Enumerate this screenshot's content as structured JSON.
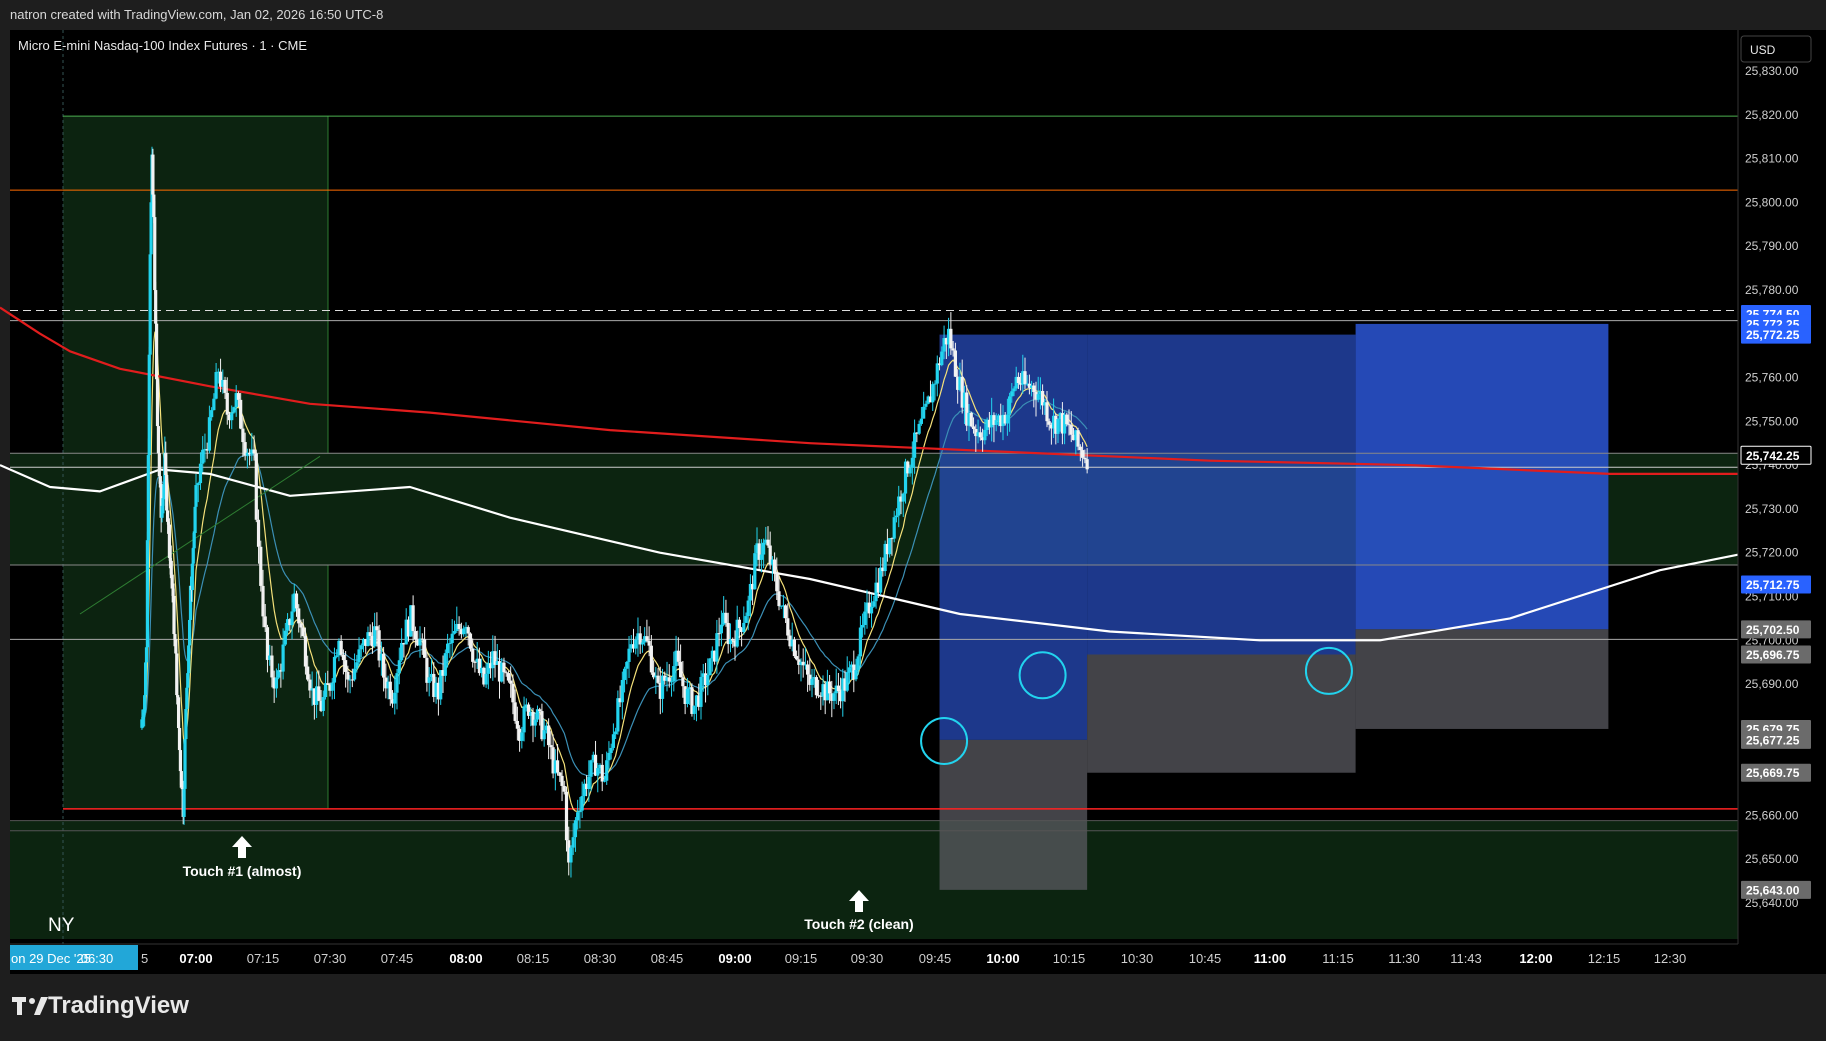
{
  "header": {
    "attribution": "natron created with TradingView.com, Jan 02, 2026 16:50 UTC-8"
  },
  "chart_title": "Micro E-mini Nasdaq-100 Index Futures · 1 · CME",
  "currency": "USD",
  "footer": {
    "brand": "TradingView"
  },
  "session_label": "NY",
  "annotations": [
    {
      "text": "Touch #1 (almost)",
      "time": "07:15"
    },
    {
      "text": "Touch #2 (clean)",
      "time": "09:30"
    }
  ],
  "chart_data": {
    "type": "candlestick",
    "symbol": "Micro E-mini Nasdaq-100 Index Futures",
    "interval": "1",
    "exchange": "CME",
    "ylim": [
      25636,
      25836
    ],
    "y_ticks": [
      "25,830.00",
      "25,820.00",
      "25,810.00",
      "25,800.00",
      "25,790.00",
      "25,780.00",
      "25,770.00",
      "25,760.00",
      "25,750.00",
      "25,740.00",
      "25,730.00",
      "25,720.00",
      "25,710.00",
      "25,700.00",
      "25,690.00",
      "25,680.00",
      "25,670.00",
      "25,660.00",
      "25,650.00",
      "25,640.00"
    ],
    "x_ticks": [
      {
        "label": "on 29 Dec '25",
        "highlight": true
      },
      {
        "label": "06:30",
        "highlight": true
      },
      {
        "label": "07:00",
        "bold": true
      },
      {
        "label": "07:15"
      },
      {
        "label": "07:30"
      },
      {
        "label": "07:45"
      },
      {
        "label": "08:00",
        "bold": true
      },
      {
        "label": "08:15"
      },
      {
        "label": "08:30"
      },
      {
        "label": "08:45"
      },
      {
        "label": "09:00",
        "bold": true
      },
      {
        "label": "09:15"
      },
      {
        "label": "09:30"
      },
      {
        "label": "09:45"
      },
      {
        "label": "10:00",
        "bold": true
      },
      {
        "label": "10:15"
      },
      {
        "label": "10:30"
      },
      {
        "label": "10:45"
      },
      {
        "label": "11:00",
        "bold": true
      },
      {
        "label": "11:15"
      },
      {
        "label": "11:30"
      },
      {
        "label": "11:43"
      },
      {
        "label": "12:00",
        "bold": true
      },
      {
        "label": "12:15"
      },
      {
        "label": "12:30"
      }
    ],
    "price_labels": [
      {
        "text": "25,774.50",
        "value": 25774.5,
        "type": "blue"
      },
      {
        "text": "25,772.25",
        "value": 25772.25,
        "type": "blue"
      },
      {
        "text": "25,772.25",
        "value": 25769.8,
        "type": "blue"
      },
      {
        "text": "25,742.25",
        "value": 25742.25,
        "type": "current"
      },
      {
        "text": "25,712.75",
        "value": 25712.75,
        "type": "blue"
      },
      {
        "text": "25,702.50",
        "value": 25702.5,
        "type": "gray"
      },
      {
        "text": "25,696.75",
        "value": 25696.75,
        "type": "gray"
      },
      {
        "text": "25,679.75",
        "value": 25679.75,
        "type": "gray"
      },
      {
        "text": "25,677.25",
        "value": 25677.25,
        "type": "gray"
      },
      {
        "text": "25,669.75",
        "value": 25669.75,
        "type": "gray"
      },
      {
        "text": "25,643.00",
        "value": 25643.0,
        "type": "gray"
      }
    ],
    "horizontal_levels": [
      {
        "value": 25819.7,
        "color": "#4caf50"
      },
      {
        "value": 25802.8,
        "color": "#ff6d00"
      },
      {
        "value": 25775.3,
        "color": "#dddddd",
        "style": "dashed"
      },
      {
        "value": 25773.0,
        "color": "#aaaaaa"
      },
      {
        "value": 25742.7,
        "color": "#888888"
      },
      {
        "value": 25739.5,
        "color": "#cccccc"
      },
      {
        "value": 25717.2,
        "color": "#888888"
      },
      {
        "value": 25700.2,
        "color": "#aaaaaa"
      },
      {
        "value": 25661.5,
        "color": "#ff2222"
      },
      {
        "value": 25658.8,
        "color": "#555555"
      },
      {
        "value": 25656.5,
        "color": "#555555"
      }
    ],
    "colors": {
      "up": "#22d3ee",
      "down": "#f2f2f2",
      "ema_fast": "#f5e17a",
      "ema_mid": "#3b8fb5",
      "vwap": "#ffffff",
      "ma_long": "#e11d1d",
      "position_target": "#2c56d6",
      "position_stop": "#5a5a60",
      "zone": "#0c2410"
    },
    "trades": [
      {
        "entry": 25677.25,
        "stop": 25643.0,
        "target": 25769.8,
        "start": "09:46",
        "end": "10:19"
      },
      {
        "entry": 25696.75,
        "stop": 25669.75,
        "target": 25769.8,
        "start": "10:19",
        "end": "11:19"
      },
      {
        "entry": 25702.5,
        "stop": 25679.75,
        "target": 25772.25,
        "start": "11:19",
        "end": "12:16"
      }
    ],
    "candles": []
  }
}
